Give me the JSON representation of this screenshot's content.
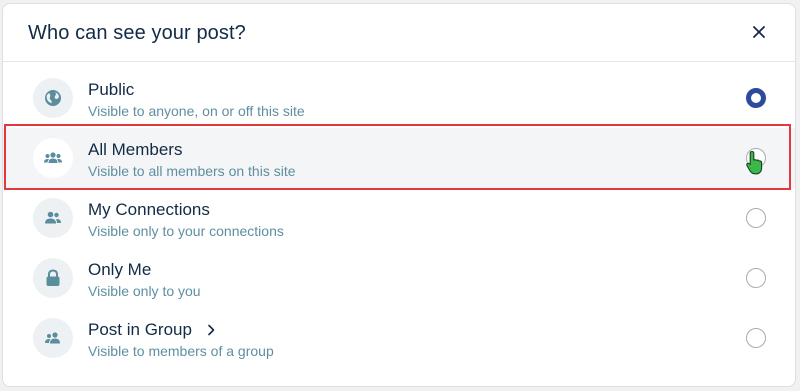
{
  "dialog": {
    "title": "Who can see your post?",
    "close_icon": "close-icon"
  },
  "colors": {
    "title": "#122b46",
    "subtitle": "#5e8fa0",
    "icon": "#5a8d9e",
    "radio_selected": "#2c4b9c",
    "highlight_border": "#e0393e",
    "cursor_green": "#3bb84a"
  },
  "options": [
    {
      "title": "Public",
      "subtitle": "Visible to anyone, on or off this site",
      "icon": "globe-icon",
      "selected": true
    },
    {
      "title": "All Members",
      "subtitle": "Visible to all members on this site",
      "icon": "members-group-icon",
      "selected": false,
      "hovered": true
    },
    {
      "title": "My Connections",
      "subtitle": "Visible only to your connections",
      "icon": "connections-icon",
      "selected": false
    },
    {
      "title": "Only Me",
      "subtitle": "Visible only to you",
      "icon": "lock-icon",
      "selected": false
    },
    {
      "title": "Post in Group",
      "subtitle": "Visible to members of a group",
      "icon": "group-icon",
      "selected": false,
      "has_chevron": true
    }
  ]
}
